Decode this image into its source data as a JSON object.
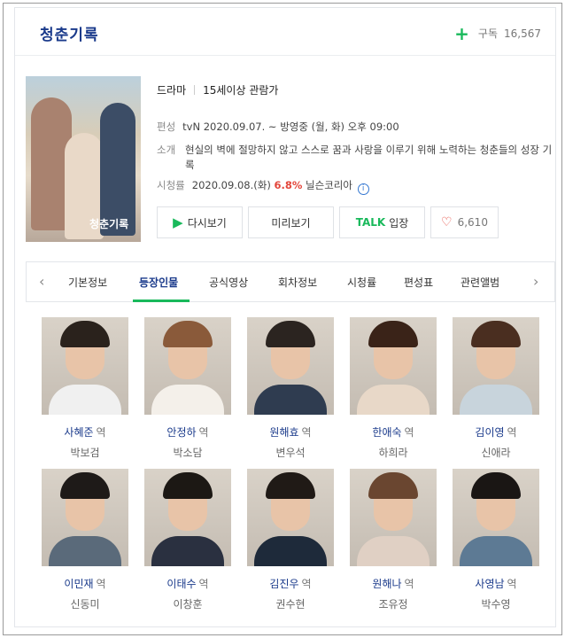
{
  "header": {
    "title": "청춘기록",
    "subscribe_label": "구독",
    "subscribe_count": "16,567"
  },
  "poster": {
    "title_text": "청춘기록"
  },
  "info": {
    "genre": "드라마",
    "rating": "15세이상 관람가",
    "schedule_label": "편성",
    "schedule_value": "tvN 2020.09.07. ~ 방영중  (월, 화) 오후 09:00",
    "summary_label": "소개",
    "summary_value": "현실의 벽에 절망하지 않고 스스로 꿈과 사랑을 이루기 위해 노력하는 청춘들의 성장 기록",
    "ratings_label": "시청률",
    "ratings_date": "2020.09.08.(화)",
    "ratings_value": "6.8%",
    "ratings_source": "닐슨코리아"
  },
  "buttons": {
    "replay": "다시보기",
    "preview": "미리보기",
    "talk_brand": "TALK",
    "talk": "입장",
    "likes": "6,610"
  },
  "tabs": [
    "기본정보",
    "등장인물",
    "공식영상",
    "회차정보",
    "시청률",
    "편성표",
    "관련앨범"
  ],
  "active_tab": "등장인물",
  "role_suffix": "역",
  "cast": [
    {
      "role": "사혜준",
      "actor": "박보검",
      "hair": "#2a221c",
      "body": "#f0f0f0"
    },
    {
      "role": "안정하",
      "actor": "박소담",
      "hair": "#8a5a3a",
      "body": "#f4f0ea"
    },
    {
      "role": "원해효",
      "actor": "변우석",
      "hair": "#2b2420",
      "body": "#2f3c50"
    },
    {
      "role": "한애숙",
      "actor": "하희라",
      "hair": "#3a2318",
      "body": "#e8d8c8"
    },
    {
      "role": "김이영",
      "actor": "신애라",
      "hair": "#4a2e20",
      "body": "#c8d4dc"
    },
    {
      "role": "이민재",
      "actor": "신동미",
      "hair": "#1e1a18",
      "body": "#5a6a7a"
    },
    {
      "role": "이태수",
      "actor": "이창훈",
      "hair": "#1c1814",
      "body": "#2a3040"
    },
    {
      "role": "김진우",
      "actor": "권수현",
      "hair": "#201a16",
      "body": "#1e2a3a"
    },
    {
      "role": "원해나",
      "actor": "조유정",
      "hair": "#6a4630",
      "body": "#e0d0c4"
    },
    {
      "role": "사영남",
      "actor": "박수영",
      "hair": "#1a1614",
      "body": "#5d7a94"
    }
  ]
}
